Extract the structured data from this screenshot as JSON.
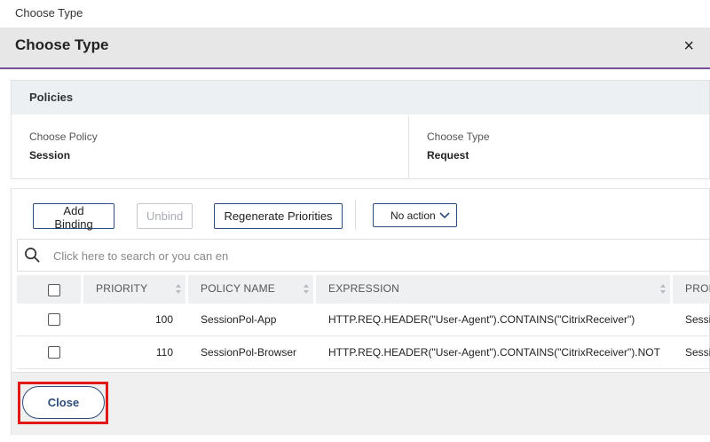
{
  "breadcrumb": "Choose Type",
  "header": {
    "title": "Choose Type",
    "close_glyph": "×"
  },
  "policies": {
    "section_title": "Policies",
    "choose_policy_label": "Choose Policy",
    "choose_policy_value": "Session",
    "choose_type_label": "Choose Type",
    "choose_type_value": "Request"
  },
  "toolbar": {
    "add_binding": "Add Binding",
    "unbind": "Unbind",
    "regenerate_priorities": "Regenerate Priorities",
    "action_select": "No action"
  },
  "search": {
    "placeholder": "Click here to search or you can en"
  },
  "table": {
    "columns": [
      "PRIORITY",
      "POLICY NAME",
      "EXPRESSION",
      "PROF"
    ],
    "rows": [
      {
        "priority": "100",
        "policy_name": "SessionPol-App",
        "expression": "HTTP.REQ.HEADER(\"User-Agent\").CONTAINS(\"CitrixReceiver\")",
        "profile": "Sessi"
      },
      {
        "priority": "110",
        "policy_name": "SessionPol-Browser",
        "expression": "HTTP.REQ.HEADER(\"User-Agent\").CONTAINS(\"CitrixReceiver\").NOT",
        "profile": "Sessi"
      }
    ]
  },
  "footer": {
    "close_label": "Close"
  },
  "colors": {
    "accent": "#7a4f9a",
    "button_border": "#2e4d7b",
    "highlight": "#e01818"
  },
  "icons": {
    "close": "close-icon",
    "search": "search-icon",
    "chevron": "chevron-down-icon",
    "sort": "sort-icon"
  }
}
